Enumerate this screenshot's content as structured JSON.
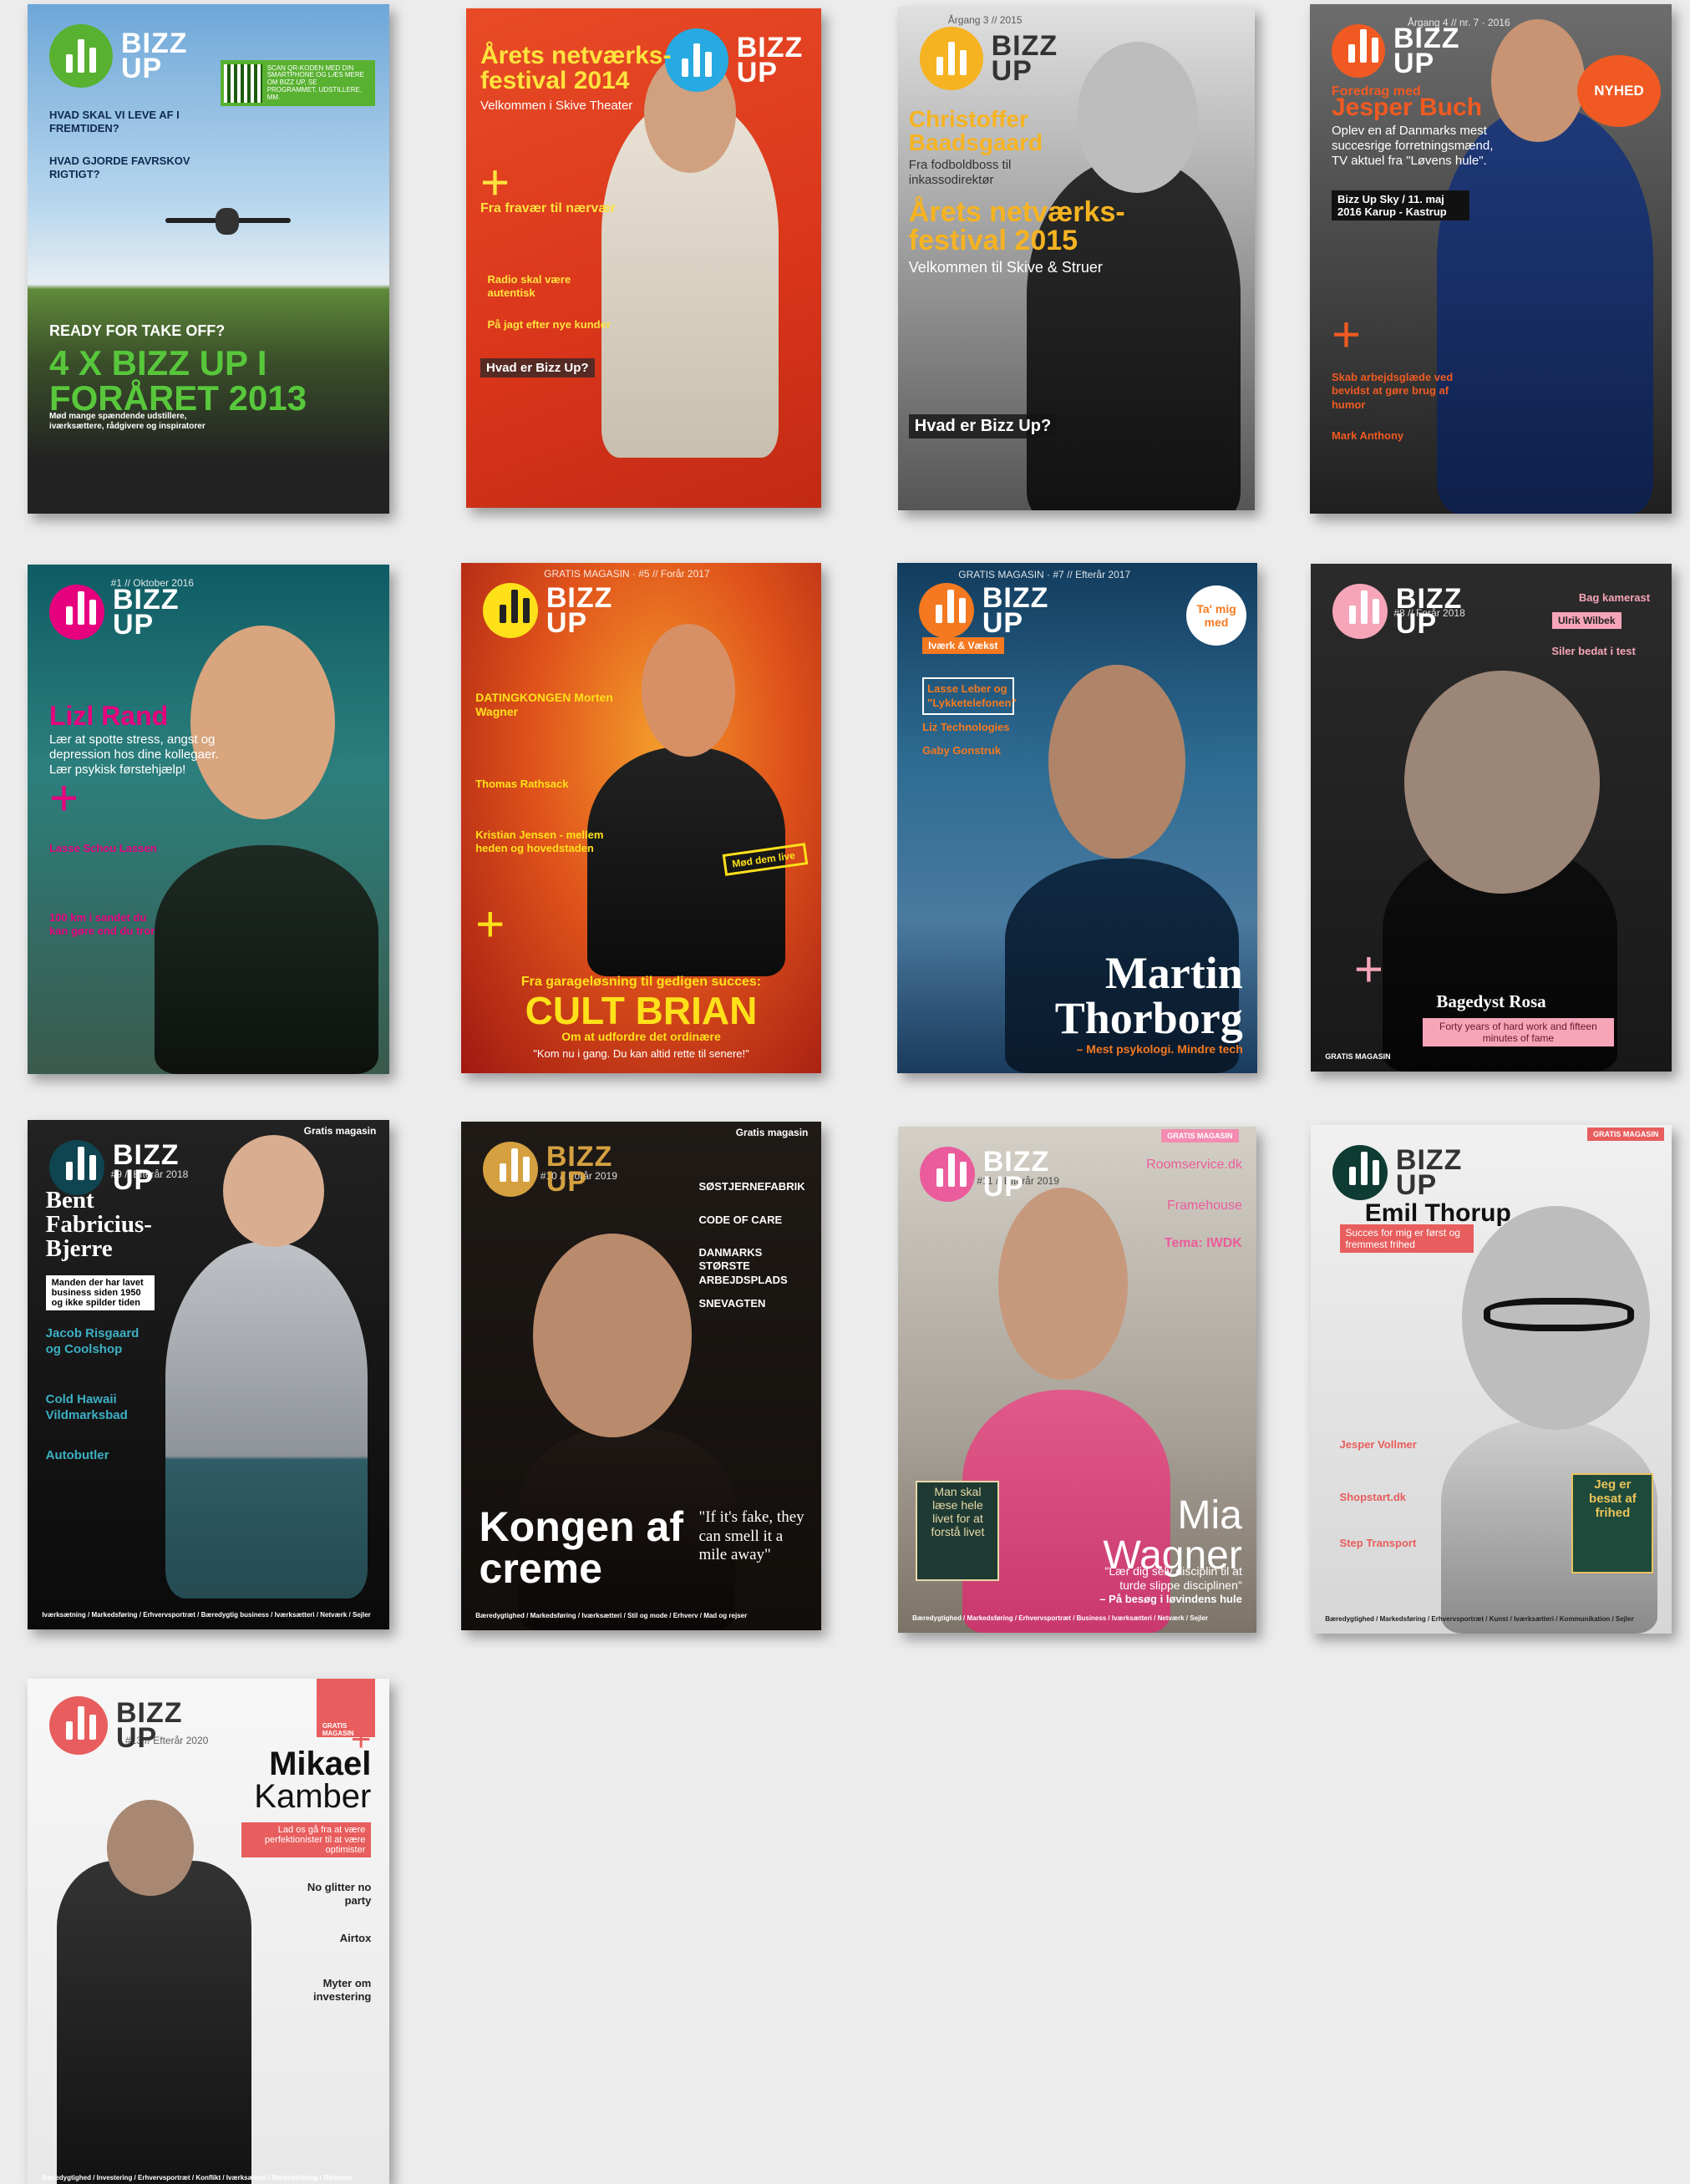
{
  "logo_text": "BIZZ UP",
  "covers": [
    {
      "id": "2013",
      "headline": "4 X BIZZ UP I FORÅRET 2013",
      "kicker": "READY FOR TAKE OFF?",
      "sub": "Mød mange spændende udstillere, iværksættere, rådgivere og inspiratorer",
      "lines": [
        "HVAD SKAL VI LEVE AF I FREMTIDEN?",
        "HVAD GJORDE FAVRSKOV RIGTIGT?"
      ],
      "qr_text": "SCAN QR-KODEN MED DIN SMARTPHONE OG LÆS MERE OM BIZZ UP, SE PROGRAMMET, UDSTILLERE, MM."
    },
    {
      "id": "2014",
      "headline": "Årets netværks-festival 2014",
      "sub": "Velkommen i Skive Theater",
      "lines": [
        "Fra fravær til nærvær",
        "Radio skal være autentisk",
        "På jagt efter nye kunder"
      ],
      "box": "Hvad er Bizz Up?"
    },
    {
      "id": "2015",
      "issue": "Årgang 3 // 2015",
      "name": "Christoffer Baadsgaard",
      "name_sub": "Fra fodboldboss til inkassodirektør",
      "headline": "Årets netværks-festival 2015",
      "sub": "Velkommen til Skive & Struer",
      "box": "Hvad er Bizz Up?"
    },
    {
      "id": "2016",
      "issue": "Årgang 4 // nr. 7 · 2016",
      "kicker": "Foredrag med",
      "headline": "Jesper Buch",
      "sub": "Oplev en af Danmarks mest succesrige forretningsmænd, TV aktuel fra \"Løvens hule\".",
      "event": "Bizz Up Sky / 11. maj 2016 Karup - Kastrup",
      "badge": "NYHED",
      "lines": [
        "Skab arbejdsglæde ved bevidst at gøre brug af humor",
        "Mark Anthony"
      ]
    },
    {
      "id": "lizl",
      "issue": "#1 // Oktober 2016",
      "headline": "Lizl Rand",
      "sub": "Lær at spotte stress, angst og depression hos dine kollegaer. Lær psykisk førstehjælp!",
      "lines": [
        "Lasse Schou Lassen",
        "100 km i sandet du kan gøre end du tror"
      ]
    },
    {
      "id": "brian",
      "issue": "GRATIS MAGASIN · #5 // Forår 2017",
      "lines": [
        "DATINGKONGEN Morten Wagner",
        "Thomas Rathsack",
        "Kristian Jensen - mellem heden og hovedstaden"
      ],
      "kicker": "Fra garageløsning til gedigen succes:",
      "headline": "CULT BRIAN",
      "sub": "Om at udfordre det ordinære",
      "quote": "\"Kom nu i gang. Du kan altid rette til senere!\"",
      "badge": "Mød dem live"
    },
    {
      "id": "martin",
      "issue": "GRATIS MAGASIN · #7 // Efterår 2017",
      "sticker": "Ta' mig med",
      "headline": "Martin Thorborg",
      "sub": "– Mest psykologi. Mindre tech",
      "lines": [
        "Iværk & Vækst",
        "Lasse Leber og \"Lykketelefonen\"",
        "Liz Technologies",
        "Gaby Gonstruk"
      ]
    },
    {
      "id": "rosa",
      "issue": "#8 // Forår 2018",
      "headline": "Bagedyst Rosa",
      "sub": "Forty years of hard work and fifteen minutes of fame",
      "lines": [
        "Bag kamerast",
        "Ulrik Wilbek",
        "Siler bedat i test"
      ],
      "footer": "GRATIS MAGASIN"
    },
    {
      "id": "bent",
      "issue": "#9 // Efterår 2018",
      "tag": "Gratis magasin",
      "headline": "Bent Fabricius-Bjerre",
      "sub": "Manden der har lavet business siden 1950 og ikke spilder tiden",
      "lines": [
        "Jacob Risgaard og Coolshop",
        "Cold Hawaii Vildmarksbad",
        "Autobutler"
      ],
      "footer": "Iværksætning / Markedsføring / Erhvervsportræt / Bæredygtig business / Iværksætteri / Netværk / Sejler"
    },
    {
      "id": "kongen",
      "issue": "#10 // Forår 2019",
      "tag": "Gratis magasin",
      "headline": "Kongen af creme",
      "quote": "\"If it's fake, they can smell it a mile away\"",
      "lines": [
        "SØSTJERNEFABRIK",
        "CODE OF CARE",
        "DANMARKS STØRSTE ARBEJDSPLADS",
        "SNEVAGTEN"
      ],
      "footer": "Bæredygtighed / Markedsføring / Iværksætteri / Stil og mode / Erhverv / Mad og rejser"
    },
    {
      "id": "mia",
      "issue": "#11 // Efterår 2019",
      "tag": "GRATIS MAGASIN",
      "headline": "Mia Wagner",
      "quote": "\"Lær dig selv disciplin til at turde slippe disciplinen\"",
      "sub": "– På besøg i løvindens hule",
      "lines": [
        "Roomservice.dk",
        "Framehouse",
        "Tema: IWDK"
      ],
      "box": "Man skal læse hele livet for at forstå livet",
      "footer": "Bæredygtighed / Markedsføring / Erhvervsportræt / Business / Iværksætteri / Netværk / Sejler"
    },
    {
      "id": "emil",
      "tag": "GRATIS MAGASIN",
      "headline": "Emil Thorup",
      "sub": "Succes for mig er først og fremmest frihed",
      "lines": [
        "Jesper Vollmer",
        "Shopstart.dk",
        "Step Transport"
      ],
      "box": "Jeg er besat af frihed",
      "footer": "Bæredygtighed / Markedsføring / Erhvervsportræt / Kunst / Iværksætteri / Kommunikation / Sejler"
    },
    {
      "id": "mikael",
      "issue": "#13 // Efterår 2020",
      "tag": "GRATIS MAGASIN",
      "headline_1": "Mikael",
      "headline_2": "Kamber",
      "sub": "Lad os gå fra at være perfektionister til at være optimister",
      "lines": [
        "No glitter no party",
        "Airtox",
        "Myter om investering"
      ],
      "footer": "Bæredygtighed / Investering / Erhvervsportræt / Konflikt / Iværksætteri / Markedsføring / Økonomi"
    }
  ]
}
